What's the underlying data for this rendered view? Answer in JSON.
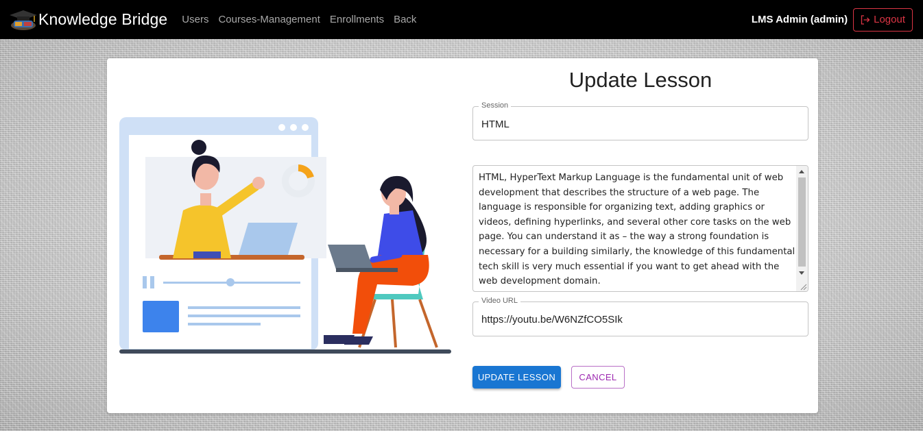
{
  "navbar": {
    "brand": "Knowledge Bridge",
    "links": [
      "Users",
      "Courses-Management",
      "Enrollments",
      "Back"
    ],
    "user": "LMS Admin (admin)",
    "logout_label": "Logout"
  },
  "form": {
    "title": "Update Lesson",
    "session": {
      "label": "Session",
      "value": "HTML"
    },
    "description": {
      "value": "HTML, HyperText Markup Language is the fundamental unit of web development that describes the structure of a web page. The language is responsible for organizing text, adding graphics or videos, defining hyperlinks, and several other core tasks on the web page. You can understand it as – the way a strong foundation is necessary for a building similarly, the knowledge of this fundamental tech skill is very much essential if you want to get ahead with the web development domain."
    },
    "video_url": {
      "label": "Video URL",
      "value": "https://youtu.be/W6NZfCO5SIk"
    },
    "update_label": "UPDATE LESSON",
    "cancel_label": "CANCEL"
  },
  "colors": {
    "navbar_bg": "#000000",
    "primary": "#1976d2",
    "cancel": "#9c27b0",
    "logout": "#dc3545"
  },
  "icons": [
    "graduation-cap-logo-icon",
    "logout-icon"
  ]
}
